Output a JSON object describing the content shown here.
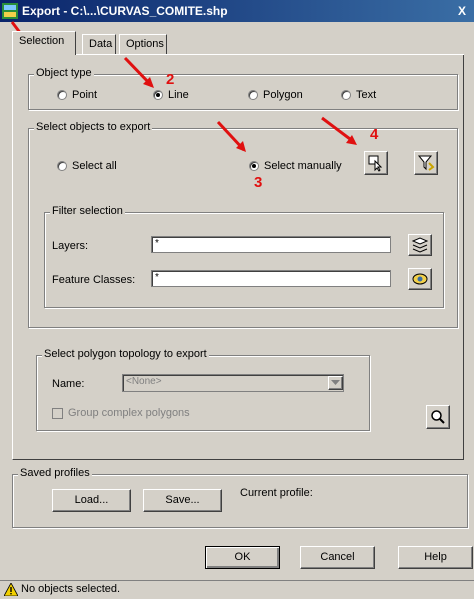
{
  "window": {
    "title": "Export - C:\\...\\CURVAS_COMITE.shp",
    "close_label": "X"
  },
  "tabs": [
    {
      "label": "Selection",
      "active": true
    },
    {
      "label": "Data",
      "active": false
    },
    {
      "label": "Options",
      "active": false
    }
  ],
  "object_type": {
    "legend": "Object type",
    "options": [
      "Point",
      "Line",
      "Polygon",
      "Text"
    ],
    "selected": "Line"
  },
  "select_objects": {
    "legend": "Select objects to export",
    "select_all_label": "Select all",
    "select_manually_label": "Select manually",
    "selected": "Select manually"
  },
  "filter": {
    "legend": "Filter selection",
    "layers_label": "Layers:",
    "layers_value": "*",
    "feature_classes_label": "Feature Classes:",
    "feature_classes_value": "*"
  },
  "polygon_topology": {
    "legend": "Select polygon topology to export",
    "name_label": "Name:",
    "name_value": "<None>",
    "group_complex_label": "Group complex polygons"
  },
  "profiles": {
    "legend": "Saved profiles",
    "load_label": "Load...",
    "save_label": "Save...",
    "current_profile_label": "Current profile:"
  },
  "buttons": {
    "ok": "OK",
    "cancel": "Cancel",
    "help": "Help"
  },
  "status": {
    "text": "No objects selected."
  },
  "annotations": [
    "1",
    "2",
    "3",
    "4"
  ],
  "colors": {
    "titlebar": "#0a246a",
    "annotation": "#e01010",
    "face": "#d4d0c8"
  }
}
